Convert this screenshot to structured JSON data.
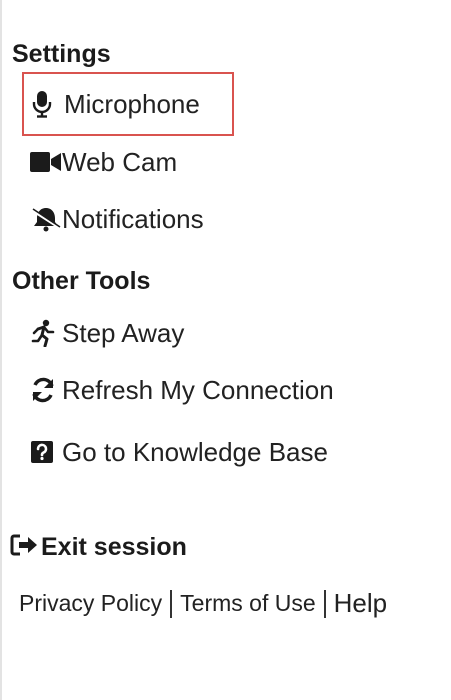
{
  "settings": {
    "heading": "Settings",
    "items": [
      {
        "label": "Microphone",
        "icon": "microphone-icon"
      },
      {
        "label": "Web Cam",
        "icon": "video-camera-icon"
      },
      {
        "label": "Notifications",
        "icon": "bell-slash-icon"
      }
    ]
  },
  "other_tools": {
    "heading": "Other Tools",
    "items": [
      {
        "label": "Step Away",
        "icon": "running-person-icon"
      },
      {
        "label": "Refresh My Connection",
        "icon": "refresh-icon"
      },
      {
        "label": "Go to Knowledge Base",
        "icon": "question-square-icon"
      }
    ]
  },
  "exit": {
    "label": "Exit session",
    "icon": "sign-out-icon"
  },
  "footer": {
    "privacy": "Privacy Policy",
    "terms": "Terms of Use",
    "help": "Help"
  },
  "colors": {
    "highlight": "#d9534f",
    "text": "#1f1f1f"
  }
}
